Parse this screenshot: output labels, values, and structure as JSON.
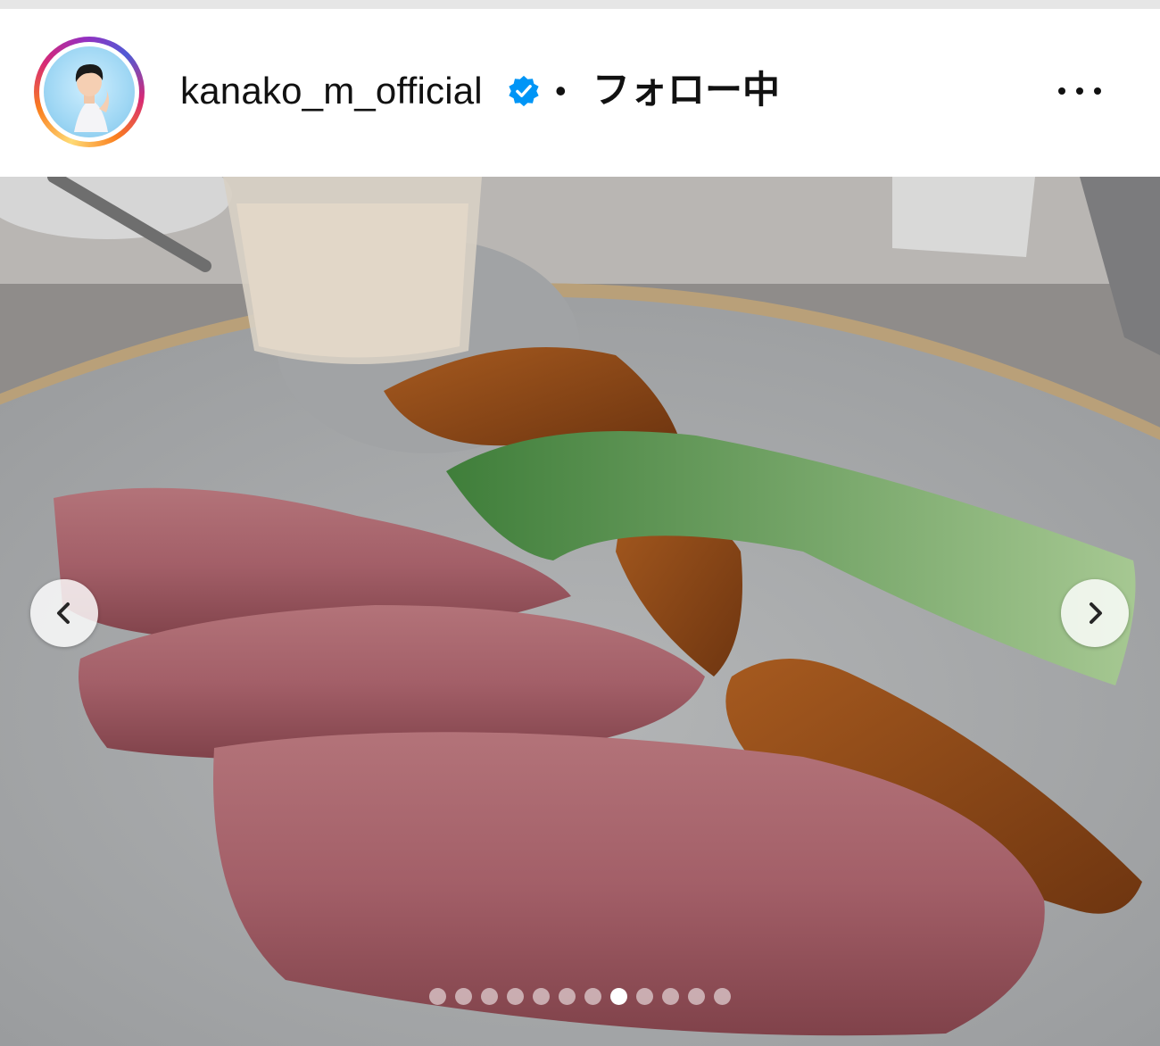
{
  "post_header": {
    "username": "kanako_m_official",
    "verified_icon": "verified-badge-icon",
    "separator": "•",
    "follow_status": "フォロー中",
    "more_icon": "more-options-icon",
    "colors": {
      "verified": "#0095f6",
      "text": "#111111"
    }
  },
  "carousel": {
    "prev_icon": "chevron-left-icon",
    "next_icon": "chevron-right-icon",
    "slide_count": 12,
    "active_index": 8
  }
}
